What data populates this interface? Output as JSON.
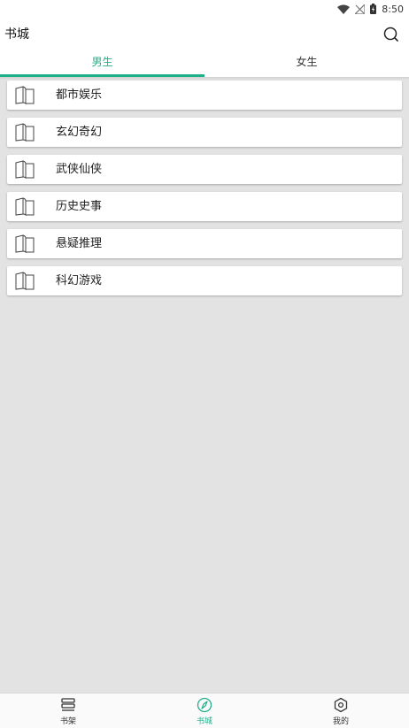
{
  "status_bar": {
    "time": "8:50"
  },
  "app_bar": {
    "title": "书城"
  },
  "tabs": [
    {
      "label": "男生",
      "active": true
    },
    {
      "label": "女生",
      "active": false
    }
  ],
  "categories": [
    {
      "label": "都市娱乐"
    },
    {
      "label": "玄幻奇幻"
    },
    {
      "label": "武侠仙侠"
    },
    {
      "label": "历史史事"
    },
    {
      "label": "悬疑推理"
    },
    {
      "label": "科幻游戏"
    }
  ],
  "bottom_nav": [
    {
      "label": "书架",
      "icon": "bookshelf-icon",
      "active": false
    },
    {
      "label": "书城",
      "icon": "compass-icon",
      "active": true
    },
    {
      "label": "我的",
      "icon": "profile-hexagon-icon",
      "active": false
    }
  ],
  "colors": {
    "accent": "#20b088",
    "background": "#e3e3e3"
  }
}
